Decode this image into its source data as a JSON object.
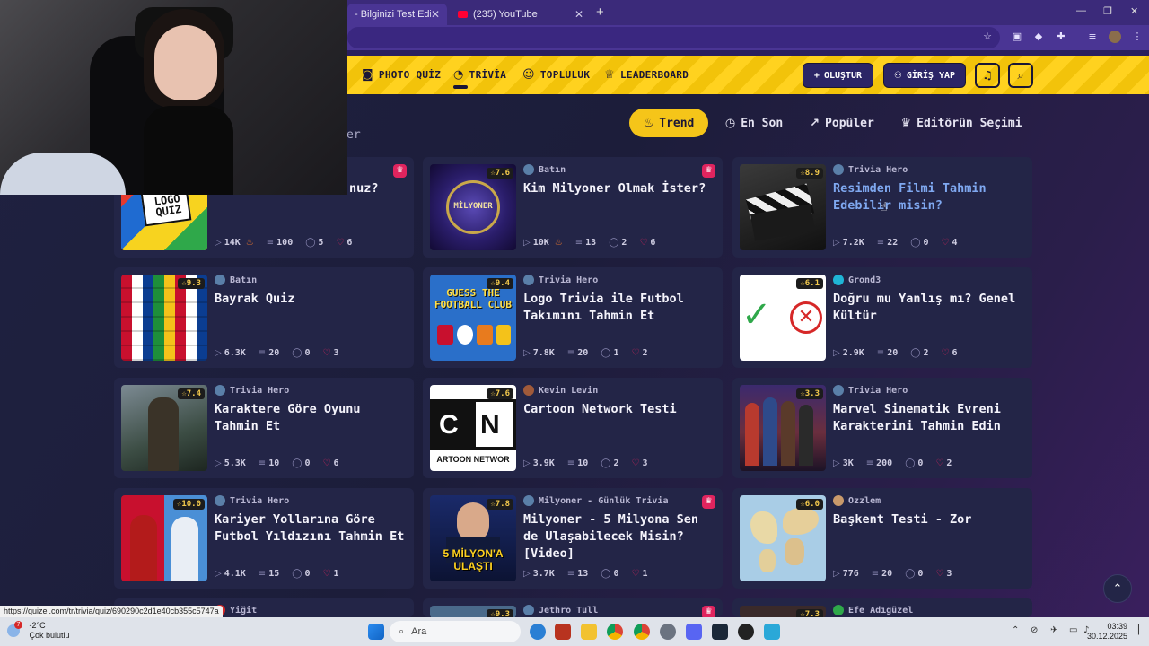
{
  "browser": {
    "tabs": [
      {
        "label": "- Bilginizi Test Edin - Quiz",
        "active": true
      },
      {
        "label": "(235) YouTube",
        "active": false
      }
    ],
    "new_tab": "+",
    "window_controls": [
      "—",
      "❐",
      "✕"
    ]
  },
  "site_nav": {
    "items": [
      {
        "icon": "camera-icon",
        "label": "PHOTO QUİZ"
      },
      {
        "icon": "chat-bubble-icon",
        "label": "TRİVİA"
      },
      {
        "icon": "users-icon",
        "label": "TOPLULUK"
      },
      {
        "icon": "trophy-icon",
        "label": "LEADERBOARD"
      }
    ],
    "active_item": "TRİVİA",
    "create_label": "OLUŞTUR",
    "login_label": "GİRİŞ YAP"
  },
  "filters": {
    "items": [
      {
        "label": "Trend",
        "icon": "flame-icon",
        "active": true
      },
      {
        "label": "En Son",
        "icon": "clock-icon",
        "active": false
      },
      {
        "label": "Popüler",
        "icon": "trend-up-icon",
        "active": false
      },
      {
        "label": "Editörün Seçimi",
        "icon": "crown-icon",
        "active": false
      }
    ],
    "partial_text": "er"
  },
  "cards": [
    {
      "thumb_text": "LOGO QUIZ",
      "rating": "",
      "author": "",
      "title": "nuz?",
      "views": "14K",
      "questions": "100",
      "comments": "5",
      "likes": "6",
      "hot": true,
      "badge": true,
      "partial": true
    },
    {
      "thumb_text": "MİLYONER",
      "rating": "7.6",
      "author": "Batın",
      "title": "Kim Milyoner Olmak İster?",
      "views": "10K",
      "questions": "13",
      "comments": "2",
      "likes": "6",
      "hot": true,
      "badge": true
    },
    {
      "thumb_text": "",
      "rating": "8.9",
      "author": "Trivia Hero",
      "title": "Resimden Filmi Tahmin Edebilir misin?",
      "views": "7.2K",
      "questions": "22",
      "comments": "0",
      "likes": "4",
      "hot": false,
      "badge": false,
      "highlight": true
    },
    {
      "thumb_text": "",
      "rating": "9.3",
      "author": "Batın",
      "title": "Bayrak Quiz",
      "views": "6.3K",
      "questions": "20",
      "comments": "0",
      "likes": "3",
      "hot": false,
      "badge": false
    },
    {
      "thumb_text": "GUESS THE FOOTBALL CLUB",
      "rating": "9.4",
      "author": "Trivia Hero",
      "title": "Logo Trivia ile Futbol Takımını Tahmin Et",
      "views": "7.8K",
      "questions": "20",
      "comments": "1",
      "likes": "2",
      "hot": false,
      "badge": false
    },
    {
      "thumb_text": "",
      "rating": "6.1",
      "author": "Grond3",
      "title": "Doğru mu Yanlış mı? Genel Kültür",
      "views": "2.9K",
      "questions": "20",
      "comments": "2",
      "likes": "6",
      "hot": false,
      "badge": false
    },
    {
      "thumb_text": "",
      "rating": "7.4",
      "author": "Trivia Hero",
      "title": "Karaktere Göre Oyunu Tahmin Et",
      "views": "5.3K",
      "questions": "10",
      "comments": "0",
      "likes": "6",
      "hot": false,
      "badge": false
    },
    {
      "thumb_text": "ARTOON NETWOR",
      "rating": "7.6",
      "author": "Kevin Levin",
      "title": "Cartoon Network Testi",
      "views": "3.9K",
      "questions": "10",
      "comments": "2",
      "likes": "3",
      "hot": false,
      "badge": false
    },
    {
      "thumb_text": "",
      "rating": "3.3",
      "author": "Trivia Hero",
      "title": "Marvel Sinematik Evreni Karakterini Tahmin Edin",
      "views": "3K",
      "questions": "200",
      "comments": "0",
      "likes": "2",
      "hot": false,
      "badge": false
    },
    {
      "thumb_text": "",
      "rating": "10.0",
      "author": "Trivia Hero",
      "title": "Kariyer Yollarına Göre Futbol Yıldızını Tahmin Et",
      "views": "4.1K",
      "questions": "15",
      "comments": "0",
      "likes": "1",
      "hot": false,
      "badge": false
    },
    {
      "thumb_text": "5 MİLYON'A ULAŞTI",
      "rating": "7.8",
      "author": "Milyoner - Günlük Trivia",
      "title": "Milyoner - 5 Milyona Sen de Ulaşabilecek Misin? [Video]",
      "views": "3.7K",
      "questions": "13",
      "comments": "0",
      "likes": "1",
      "hot": false,
      "badge": true
    },
    {
      "thumb_text": "",
      "rating": "6.0",
      "author": "Ozzlem",
      "title": "Başkent Testi - Zor",
      "views": "776",
      "questions": "20",
      "comments": "0",
      "likes": "3",
      "hot": false,
      "badge": false
    }
  ],
  "bottom_row": [
    {
      "author": "Yiğit",
      "rating": "",
      "badge": false
    },
    {
      "author": "Jethro Tull",
      "rating": "9.3",
      "badge": true
    },
    {
      "author": "Efe Adıgüzel",
      "rating": "7.3",
      "badge": false
    }
  ],
  "status_url": "https://quizei.com/tr/trivia/quiz/690290c2d1e40cb355c5747a",
  "taskbar": {
    "weather_temp": "-2°C",
    "weather_desc": "Çok bulutlu",
    "weather_badge": "7",
    "search_placeholder": "Ara",
    "time": "03:39",
    "date": "30.12.2025"
  },
  "colors": {
    "accent_yellow": "#f5c519",
    "card_bg": "#232547",
    "badge_red": "#e0245e",
    "highlight_title": "#7fa8f0"
  }
}
